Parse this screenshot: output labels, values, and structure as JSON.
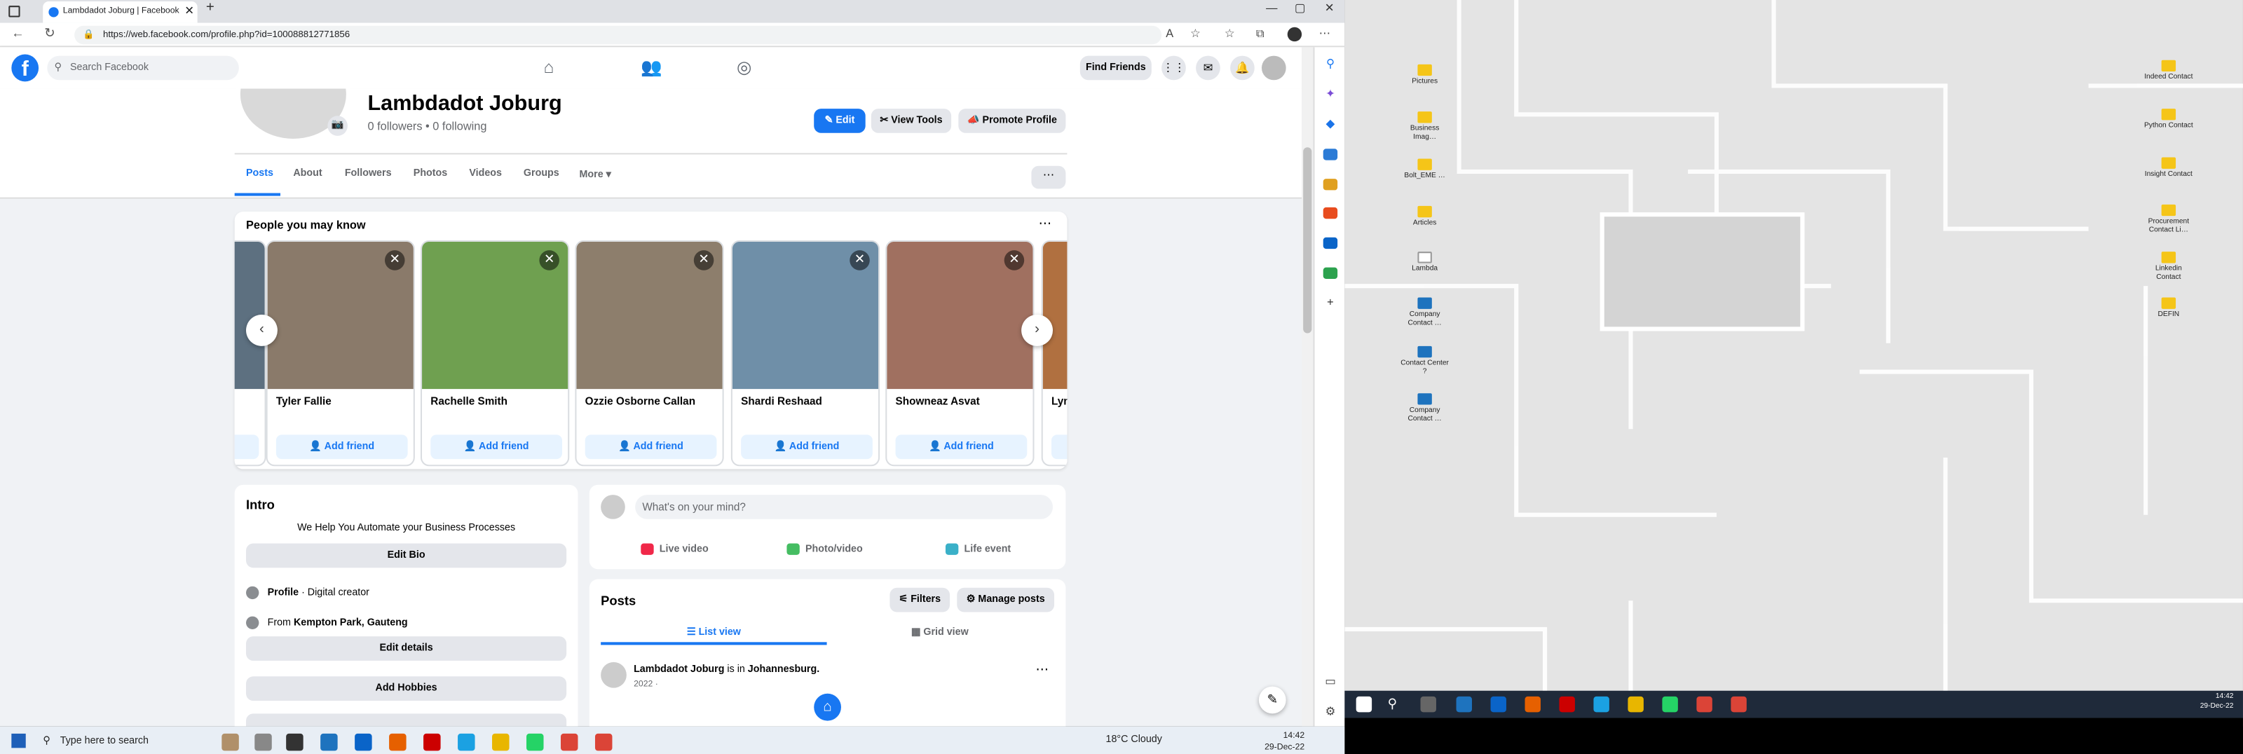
{
  "browser": {
    "tab_title": "Lambdadot Joburg | Facebook",
    "url": "https://web.facebook.com/profile.php?id=100088812771856"
  },
  "fb": {
    "search_placeholder": "Search Facebook",
    "find_friends": "Find Friends"
  },
  "profile": {
    "name": "Lambdadot Joburg",
    "followers": "0 followers • 0 following",
    "edit_label": "Edit",
    "view_tools_label": "View Tools",
    "promote_label": "Promote Profile",
    "tabs": [
      "Posts",
      "About",
      "Followers",
      "Photos",
      "Videos",
      "Groups",
      "More"
    ]
  },
  "pymk": {
    "title": "People you may know",
    "add_label": "Add friend",
    "people": [
      {
        "name": "Tyler Fallie",
        "color": "#8a7a6a"
      },
      {
        "name": "Rachelle Smith",
        "color": "#6fa050"
      },
      {
        "name": "Ozzie Osborne Callan",
        "color": "#8d7e6c"
      },
      {
        "name": "Shardi Reshaad",
        "color": "#6f8fa8"
      },
      {
        "name": "Showneaz Asvat",
        "color": "#a07060"
      }
    ],
    "partial_name": "Lyn"
  },
  "intro": {
    "title": "Intro",
    "bio": "We Help You Automate your Business Processes",
    "edit_bio": "Edit Bio",
    "profile_line_b": "Profile",
    "profile_line": " · Digital creator",
    "from_prefix": "From ",
    "from_place": "Kempton Park, Gauteng",
    "edit_details": "Edit details",
    "add_hobbies": "Add Hobbies"
  },
  "composer": {
    "placeholder": "What's on your mind?",
    "live": "Live video",
    "photo": "Photo/video",
    "life": "Life event"
  },
  "posts": {
    "title": "Posts",
    "filters": "Filters",
    "manage": "Manage posts",
    "list_view": "List view",
    "grid_view": "Grid view",
    "author": "Lambdadot Joburg",
    "is_in": " is in ",
    "place": "Johannesburg.",
    "date": "2022 ·"
  },
  "desktop": {
    "icons_left": [
      "Pictures",
      "Business Imag…",
      "Bolt_EME …",
      "Articles",
      "Lambda",
      "Company Contact …",
      "Contact Center ?",
      "Company Contact …"
    ],
    "icons_right": [
      "Indeed Contact",
      "Python Contact",
      "Insight Contact",
      "Procurement Contact Li…",
      "Linkedin Contact",
      "DEFIN"
    ],
    "time": "14:42",
    "date": "29-Dec-22"
  },
  "taskbar": {
    "search": "Type here to search",
    "weather": "18°C  Cloudy",
    "time": "14:42",
    "date": "29-Dec-22"
  }
}
